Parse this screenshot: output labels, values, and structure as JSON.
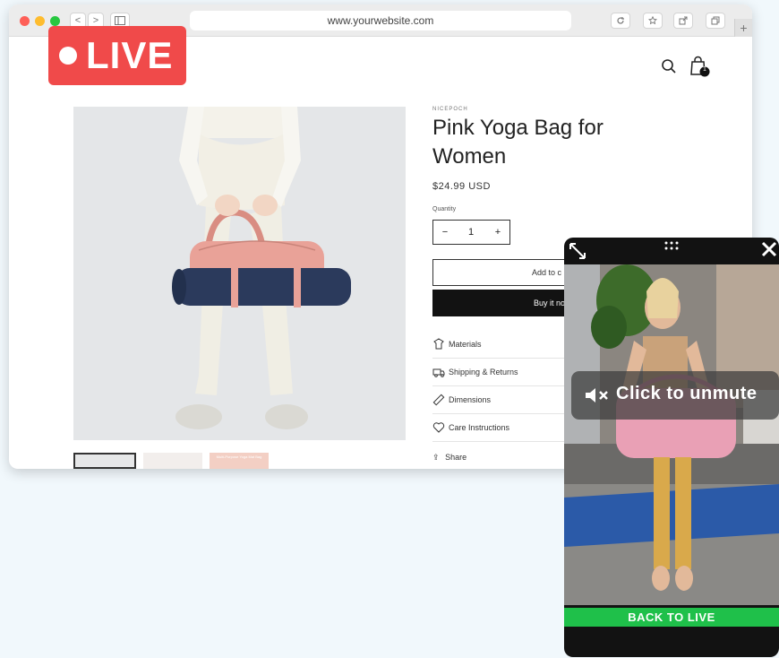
{
  "browser": {
    "url": "www.yourwebsite.com",
    "nav_back": "<",
    "nav_forward": ">",
    "new_tab": "+"
  },
  "live_badge": {
    "label": "LIVE"
  },
  "header": {
    "search_icon": "search-icon",
    "cart_icon": "shopping-bag-icon",
    "cart_count": "1"
  },
  "product": {
    "brand": "NICEPOCH",
    "title": "Pink Yoga Bag for Women",
    "price": "$24.99 USD",
    "quantity_label": "Quantity",
    "quantity_value": "1",
    "decrement": "−",
    "increment": "+",
    "add_to_cart_label": "Add to c",
    "buy_now_label": "Buy it no",
    "accordion": [
      {
        "label": "Materials",
        "icon": "materials-icon"
      },
      {
        "label": "Shipping & Returns",
        "icon": "truck-icon"
      },
      {
        "label": "Dimensions",
        "icon": "ruler-icon"
      },
      {
        "label": "Care Instructions",
        "icon": "heart-icon"
      }
    ],
    "share_label": "Share",
    "thumbnail_caption": "Multi-Purpose Yoga Mat Bag"
  },
  "video": {
    "unmute_label": "Click to unmute",
    "back_to_live_label": "BACK TO LIVE"
  },
  "colors": {
    "live_red": "#f04a4a",
    "back_live_green": "#1fc04a",
    "bag_pink": "#e9a298",
    "mat_navy": "#2b3a5c"
  }
}
